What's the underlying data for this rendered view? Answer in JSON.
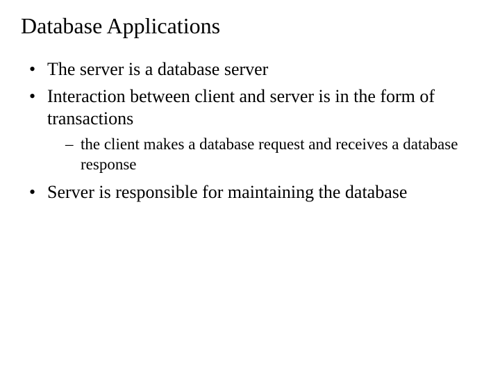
{
  "title": "Database Applications",
  "bullets": {
    "b1": "The server is a database server",
    "b2": "Interaction between client and server is in the form of transactions",
    "b2_sub1": "the client makes a database request and receives a database response",
    "b3": "Server is responsible for maintaining the database"
  }
}
